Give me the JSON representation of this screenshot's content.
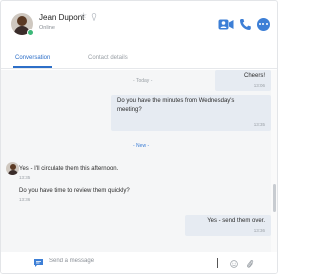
{
  "header": {
    "contact_name": "Jean Dupont",
    "status": "Online",
    "icons": {
      "favorite": "star-icon",
      "info": "info-icon",
      "video": "video-icon",
      "call": "phone-icon",
      "more": "more-icon"
    }
  },
  "tabs": [
    {
      "label": "Conversation",
      "active": true
    },
    {
      "label": "Contact details",
      "active": false
    }
  ],
  "messages": {
    "today_label": "- Today -",
    "new_label": "- New -",
    "items": [
      {
        "direction": "outgoing",
        "text": "Cheers!",
        "time": "13:06"
      },
      {
        "direction": "outgoing",
        "text_lines": [
          "Do you have the minutes from Wednesday's",
          "meeting?"
        ],
        "time": "13:35"
      },
      {
        "direction": "incoming",
        "text": "Yes - I'll circulate them this afternoon.",
        "time": "13:35"
      },
      {
        "direction": "incoming",
        "text": "Do you have time to review them quickly?",
        "time": "13:36"
      },
      {
        "direction": "outgoing",
        "text": "Yes - send them over.",
        "time": "13:36"
      }
    ]
  },
  "composer": {
    "placeholder": "Send a message",
    "value": "",
    "icons": {
      "left": "message-icon",
      "emoji": "emoji-icon",
      "attach": "paperclip-icon"
    }
  },
  "colors": {
    "accent": "#3d7fd6",
    "online": "#3cb878",
    "outgoing_bubble": "#e6ebf2",
    "message_area_bg": "#f5f6f7"
  }
}
